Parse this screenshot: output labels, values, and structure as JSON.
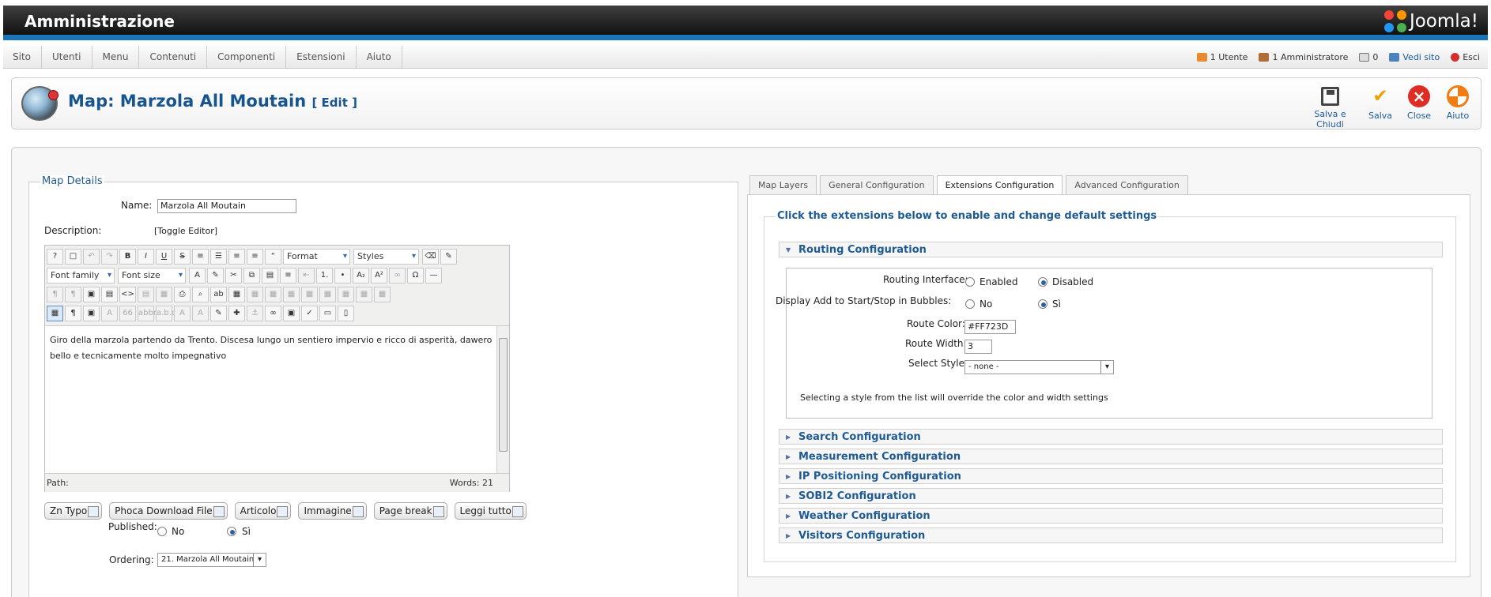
{
  "header": {
    "title": "Amministrazione",
    "brand": "Joomla!"
  },
  "menu": {
    "items": [
      "Sito",
      "Utenti",
      "Menu",
      "Contenuti",
      "Componenti",
      "Estensioni",
      "Aiuto"
    ]
  },
  "status": {
    "users": "1 Utente",
    "admins": "1 Amministratore",
    "messages": "0",
    "view_site": "Vedi sito",
    "logout": "Esci"
  },
  "page": {
    "title": "Map: Marzola All Moutain",
    "edit": "[ Edit ]"
  },
  "toolbar": {
    "save_close": "Salva e Chiudi",
    "save": "Salva",
    "close": "Close",
    "help": "Aiuto"
  },
  "details": {
    "legend": "Map Details",
    "name_label": "Name:",
    "name_value": "Marzola All Moutain",
    "description_label": "Description:",
    "toggle_editor": "[Toggle Editor]",
    "format": "Format",
    "styles": "Styles",
    "font_family": "Font family",
    "font_size": "Font size",
    "content": "Giro della marzola partendo da Trento. Discesa lungo un sentiero impervio e ricco di asperità, dawero bello e tecnicamente molto impegnativo",
    "path_label": "Path:",
    "words": "Words: 21",
    "buttons": [
      "Zn Typo",
      "Phoca Download File",
      "Articolo",
      "Immagine",
      "Page break",
      "Leggi tutto"
    ],
    "published_label": "Published:",
    "published_no": "No",
    "published_yes": "Sì",
    "ordering_label": "Ordering:",
    "ordering_value": "21. Marzola All Moutain"
  },
  "tabs": [
    {
      "label": "Map Layers",
      "active": false
    },
    {
      "label": "General Configuration",
      "active": false
    },
    {
      "label": "Extensions Configuration",
      "active": true
    },
    {
      "label": "Advanced Configuration",
      "active": false
    }
  ],
  "extensions": {
    "legend": "Click the extensions below to enable and change default settings",
    "routing": {
      "title": "Routing Configuration",
      "interface_label": "Routing Interface:",
      "enabled": "Enabled",
      "disabled": "Disabled",
      "bubbles_label": "Display Add to Start/Stop in Bubbles:",
      "no": "No",
      "yes": "Sì",
      "color_label": "Route Color:",
      "color_value": "#FF723D",
      "width_label": "Route Width:",
      "width_value": "3",
      "style_label": "Select Style:",
      "style_value": "- none -",
      "note": "Selecting a style from the list will override the color and width settings"
    },
    "sections": [
      "Search Configuration",
      "Measurement Configuration",
      "IP Positioning Configuration",
      "SOBI2 Configuration",
      "Weather Configuration",
      "Visitors Configuration"
    ]
  }
}
